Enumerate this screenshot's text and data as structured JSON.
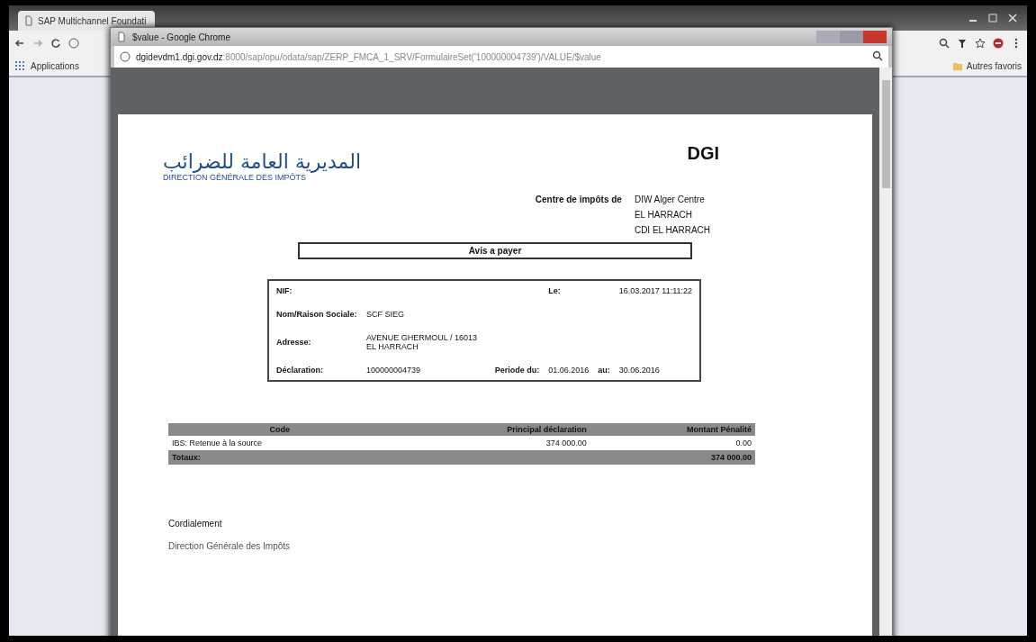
{
  "back_window": {
    "tab": {
      "title": "SAP Multichannel Foundati"
    },
    "bookmarks": [
      "Applications"
    ],
    "other_bookmarks": "Autres favoris"
  },
  "popup": {
    "title": "$value - Google Chrome",
    "url_host": "dgidevdm1.dgi.gov.dz",
    "url_path": ":8000/sap/opu/odata/sap/ZERP_FMCA_1_SRV/FormulaireSet('100000004739')/VALUE/$value"
  },
  "document": {
    "logo_arabic": "المديرية العامة للضرائب",
    "logo_french": "DIRECTION GÉNÉRALE DES IMPÔTS",
    "heading": "DGI",
    "centre_label": "Centre de impôts de",
    "centre_lines": [
      "DIW Alger Centre",
      "EL HARRACH",
      "CDI EL HARRACH"
    ],
    "notice_title": "Avis a payer",
    "info": {
      "nif_label": "NIF:",
      "date_label": "Le:",
      "date": "16.03.2017 11:11:22",
      "name_label": "Nom/Raison Sociale:",
      "name": "SCF SIEG",
      "address_label": "Adresse:",
      "address": "AVENUE GHERMOUL / 16013 EL HARRACH",
      "declaration_label": "Déclaration:",
      "declaration": "100000004739",
      "period_from_label": "Periode du:",
      "period_from": "01.06.2016",
      "period_to_label": "au:",
      "period_to": "30.06.2016"
    },
    "table": {
      "columns": [
        "Code",
        "Principal déclaration",
        "Montant Pénalité"
      ],
      "rows": [
        [
          "IBS: Retenue à la source",
          "374 000.00",
          "0.00"
        ]
      ],
      "total": {
        "label": "Totaux:",
        "amount": "374 000.00"
      }
    },
    "closing": "Cordialement",
    "signature": "Direction Générale des Impôts"
  }
}
